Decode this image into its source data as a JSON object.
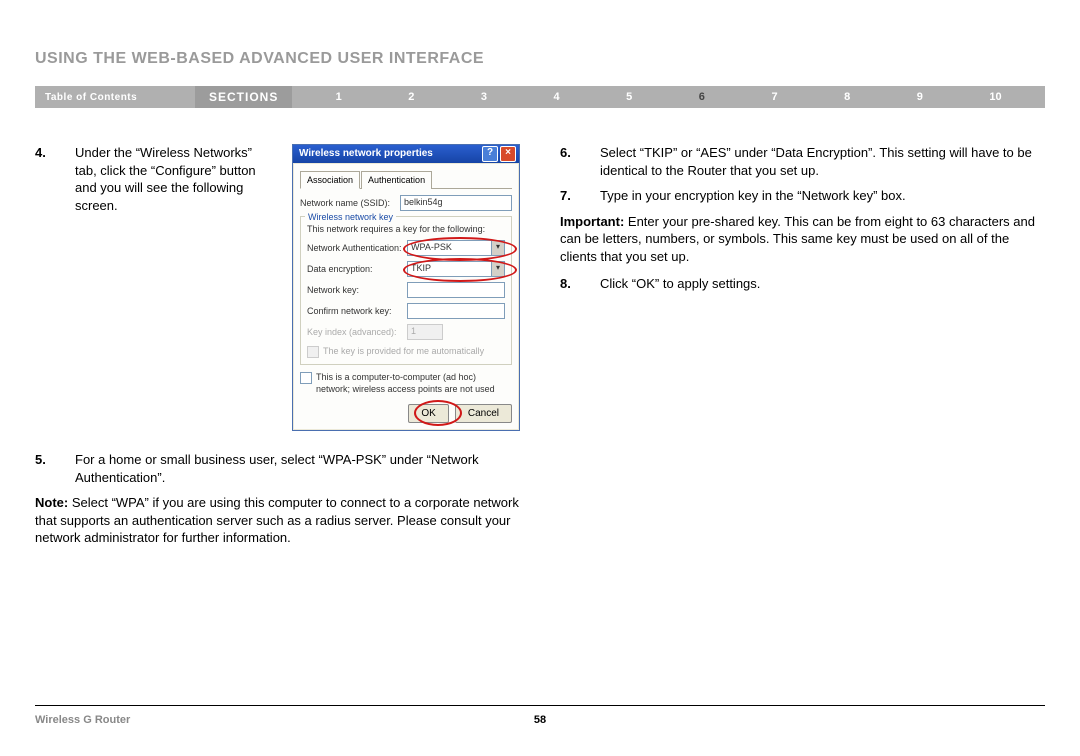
{
  "heading": "USING THE WEB-BASED ADVANCED USER INTERFACE",
  "nav": {
    "toc": "Table of Contents",
    "sections": "SECTIONS",
    "items": [
      "1",
      "2",
      "3",
      "4",
      "5",
      "6",
      "7",
      "8",
      "9",
      "10"
    ],
    "active": "6"
  },
  "steps": {
    "s4": {
      "num": "4.",
      "text": "Under the “Wireless Networks” tab, click the “Configure” button and you will see the following screen."
    },
    "s5": {
      "num": "5.",
      "text": "For a home or small business user, select “WPA-PSK” under “Network Authentication”."
    },
    "note": {
      "label": "Note:",
      "text": " Select “WPA” if you are using this computer to connect to a corporate network that supports an authentication server such as a radius server. Please consult your network administrator for further information."
    },
    "s6": {
      "num": "6.",
      "text": "Select “TKIP” or “AES” under “Data Encryption”. This setting will have to be identical to the Router that you set up."
    },
    "s7": {
      "num": "7.",
      "text": "Type in your encryption key in the “Network key” box."
    },
    "important": {
      "label": "Important:",
      "text": " Enter your pre-shared key. This can be from eight to 63 characters and can be letters, numbers, or symbols. This same key must be used on all of the clients that you set up."
    },
    "s8": {
      "num": "8.",
      "text": "Click “OK” to apply settings."
    }
  },
  "dialog": {
    "title": "Wireless network properties",
    "tabs": {
      "assoc": "Association",
      "auth": "Authentication"
    },
    "ssid_label": "Network name (SSID):",
    "ssid_value": "belkin54g",
    "group_title": "Wireless network key",
    "group_desc": "This network requires a key for the following:",
    "netauth_label": "Network Authentication:",
    "netauth_value": "WPA-PSK",
    "dataenc_label": "Data encryption:",
    "dataenc_value": "TKIP",
    "netkey_label": "Network key:",
    "confirm_label": "Confirm network key:",
    "keyindex_label": "Key index (advanced):",
    "keyindex_value": "1",
    "autokey": "The key is provided for me automatically",
    "adhoc": "This is a computer-to-computer (ad hoc) network; wireless access points are not used",
    "ok": "OK",
    "cancel": "Cancel"
  },
  "footer": {
    "product": "Wireless G Router",
    "page": "58"
  }
}
